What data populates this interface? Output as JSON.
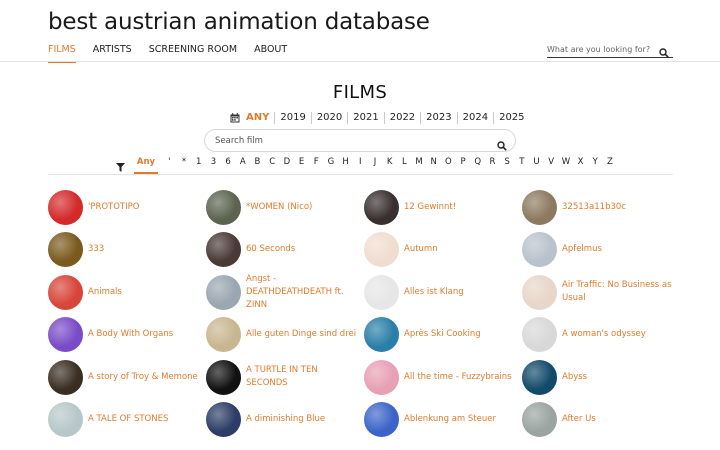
{
  "site": {
    "title": "best austrian animation database"
  },
  "nav": [
    {
      "label": "FILMS"
    },
    {
      "label": "ARTISTS"
    },
    {
      "label": "SCREENING ROOM"
    },
    {
      "label": "ABOUT"
    }
  ],
  "search": {
    "placeholder": "What are you looking for?"
  },
  "page": {
    "title": "FILMS"
  },
  "years": [
    "ANY",
    "2019",
    "2020",
    "2021",
    "2022",
    "2023",
    "2024",
    "2025"
  ],
  "film_search": {
    "placeholder": "Search film"
  },
  "letters": [
    "Any",
    "'",
    "*",
    "1",
    "3",
    "6",
    "A",
    "B",
    "C",
    "D",
    "E",
    "F",
    "G",
    "H",
    "I",
    "J",
    "K",
    "L",
    "M",
    "N",
    "O",
    "P",
    "Q",
    "R",
    "S",
    "T",
    "U",
    "V",
    "W",
    "X",
    "Y",
    "Z"
  ],
  "films": [
    {
      "title": "'PROTOTIPO",
      "color": "#d42a2a"
    },
    {
      "title": "*WOMEN (Nico)",
      "color": "#5c6450"
    },
    {
      "title": "12 Gewinnt!",
      "color": "#3a2f2f"
    },
    {
      "title": "32513a11b30c",
      "color": "#8c7a60"
    },
    {
      "title": "333",
      "color": "#7a5a1e"
    },
    {
      "title": "60 Seconds",
      "color": "#4a3a36"
    },
    {
      "title": "Autumn",
      "color": "#f0ddd0"
    },
    {
      "title": "Apfelmus",
      "color": "#b9c2cc"
    },
    {
      "title": "Animals",
      "color": "#d8453a"
    },
    {
      "title": "Angst - DEATHDEATHDEATH ft. ZINN",
      "color": "#9aa6b0"
    },
    {
      "title": "Alles ist Klang",
      "color": "#e6e6e6"
    },
    {
      "title": "Air Traffic: No Business as Usual",
      "color": "#e8d6c8"
    },
    {
      "title": "A Body With Organs",
      "color": "#7a4bc8"
    },
    {
      "title": "Alle guten Dinge sind drei",
      "color": "#c8b690"
    },
    {
      "title": "Après Ski Cooking",
      "color": "#2a7fa8"
    },
    {
      "title": "A woman's odyssey",
      "color": "#d8d8d8"
    },
    {
      "title": "A story of Troy & Memone",
      "color": "#3a2e22"
    },
    {
      "title": "A TURTLE IN TEN SECONDS",
      "color": "#111111"
    },
    {
      "title": "All the time - Fuzzybrains",
      "color": "#e8a0b4"
    },
    {
      "title": "Abyss",
      "color": "#124a6a"
    },
    {
      "title": "A TALE OF STONES",
      "color": "#b7c7c9"
    },
    {
      "title": "A diminishing Blue",
      "color": "#2c3e66"
    },
    {
      "title": "Ablenkung am Steuer",
      "color": "#3c64c8"
    },
    {
      "title": "After Us",
      "color": "#9aa4a0"
    }
  ]
}
